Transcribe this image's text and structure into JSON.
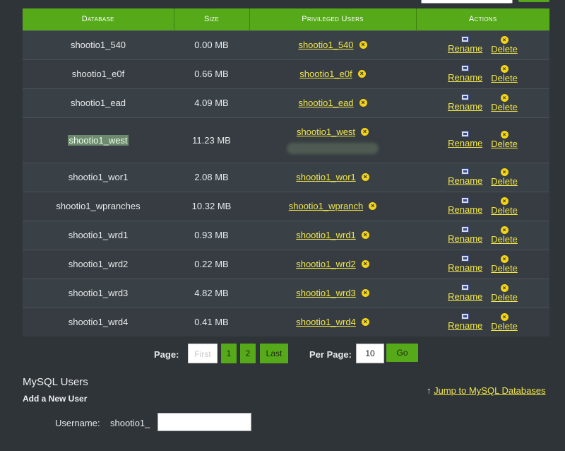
{
  "table": {
    "headers": {
      "database": "Database",
      "size": "Size",
      "privileged_users": "Privileged Users",
      "actions": "Actions"
    },
    "rows": [
      {
        "database": "shootio1_540",
        "size": "0.00 MB",
        "user": "shootio1_540"
      },
      {
        "database": "shootio1_e0f",
        "size": "0.66 MB",
        "user": "shootio1_e0f"
      },
      {
        "database": "shootio1_ead",
        "size": "4.09 MB",
        "user": "shootio1_ead"
      },
      {
        "database": "shootio1_west",
        "size": "11.23 MB",
        "user": "shootio1_west"
      },
      {
        "database": "shootio1_wor1",
        "size": "2.08 MB",
        "user": "shootio1_wor1"
      },
      {
        "database": "shootio1_wpranches",
        "size": "10.32 MB",
        "user": "shootio1_wpranch"
      },
      {
        "database": "shootio1_wrd1",
        "size": "0.93 MB",
        "user": "shootio1_wrd1"
      },
      {
        "database": "shootio1_wrd2",
        "size": "0.22 MB",
        "user": "shootio1_wrd2"
      },
      {
        "database": "shootio1_wrd3",
        "size": "4.82 MB",
        "user": "shootio1_wrd3"
      },
      {
        "database": "shootio1_wrd4",
        "size": "0.41 MB",
        "user": "shootio1_wrd4"
      }
    ],
    "rename_label": "Rename",
    "delete_label": "Delete"
  },
  "pagination": {
    "page_label": "Page:",
    "first": "First",
    "page1": "1",
    "page2": "2",
    "last": "Last",
    "per_page_label": "Per Page:",
    "per_page_value": "10",
    "go": "Go"
  },
  "users_section": {
    "title": "MySQL Users",
    "add_user": "Add a New User",
    "jump_link": "Jump to MySQL Databases",
    "username_label": "Username:",
    "username_prefix": "shootio1_"
  },
  "colors": {
    "header_green": "#56aa1a",
    "link_yellow": "#f1e64a",
    "background": "#2f3438"
  }
}
